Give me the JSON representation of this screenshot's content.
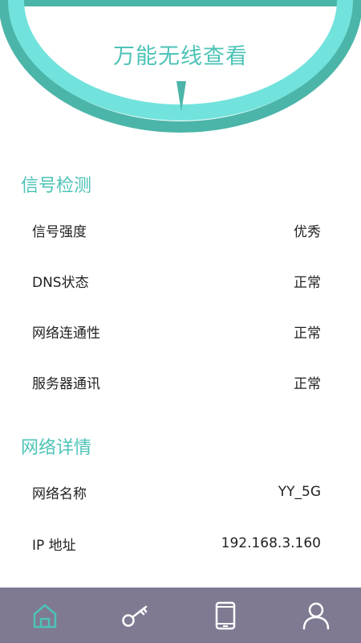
{
  "gauge": {
    "title": "万能无线查看"
  },
  "signal_section": {
    "title": "信号检测",
    "rows": [
      {
        "label": "信号强度",
        "value": "优秀"
      },
      {
        "label": "DNS状态",
        "value": "正常"
      },
      {
        "label": "网络连通性",
        "value": "正常"
      },
      {
        "label": "服务器通讯",
        "value": "正常"
      }
    ]
  },
  "network_section": {
    "title": "网络详情",
    "rows": [
      {
        "label": "网络名称",
        "value": "YY_5G"
      },
      {
        "label": "IP 地址",
        "value": "192.168.3.160"
      }
    ]
  },
  "bottom_nav": {
    "items": [
      {
        "icon": "home-icon",
        "active": true
      },
      {
        "icon": "key-icon",
        "active": false
      },
      {
        "icon": "phone-icon",
        "active": false
      },
      {
        "icon": "user-icon",
        "active": false
      }
    ]
  },
  "colors": {
    "accent": "#4dc3b7",
    "ring_light": "#72e2dc",
    "ring_dark": "#4bb5a9",
    "nav_background": "#7f7a92",
    "nav_active": "#4dc3b7",
    "nav_inactive": "#ffffff"
  }
}
